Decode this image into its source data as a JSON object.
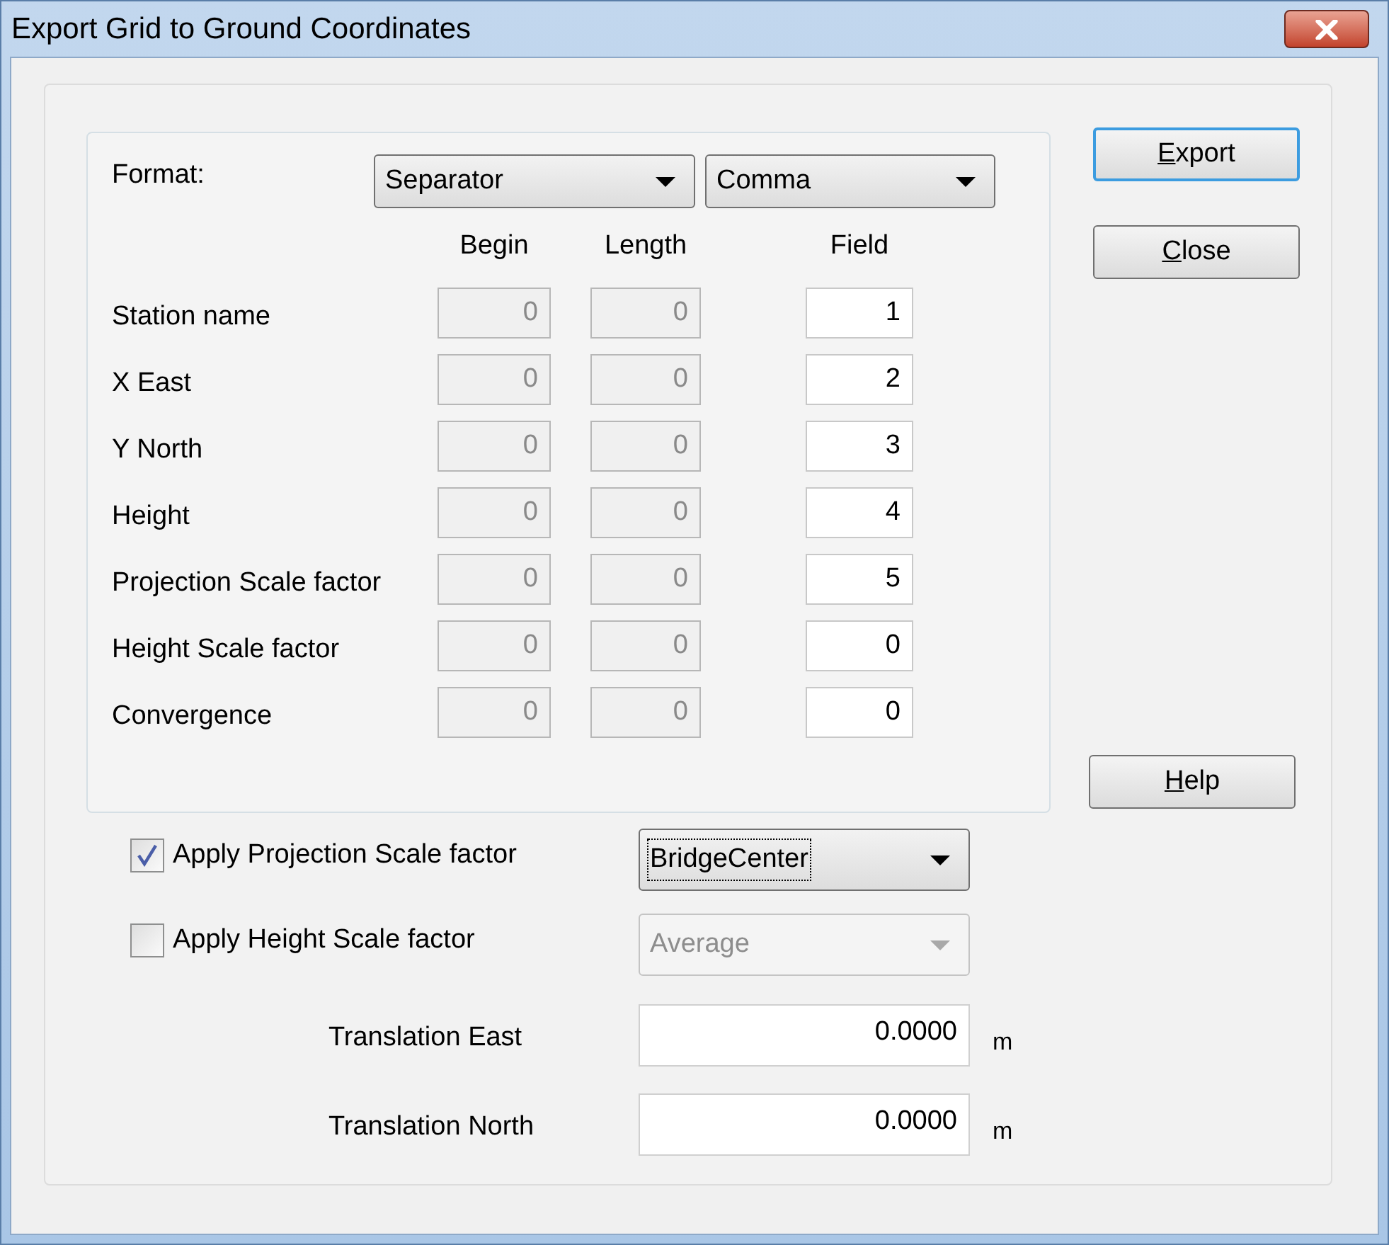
{
  "window": {
    "title": "Export Grid to Ground Coordinates"
  },
  "format": {
    "label": "Format:",
    "dropdowns": [
      {
        "value": "Separator",
        "disabled": false
      },
      {
        "value": "Comma",
        "disabled": false
      }
    ]
  },
  "columns": [
    {
      "label": "Begin",
      "disabled": true
    },
    {
      "label": "Length",
      "disabled": true
    },
    {
      "label": "Field",
      "disabled": false
    }
  ],
  "rows": [
    {
      "label": "Station name",
      "values": [
        "0",
        "0",
        "1"
      ]
    },
    {
      "label": "X East",
      "values": [
        "0",
        "0",
        "2"
      ]
    },
    {
      "label": "Y North",
      "values": [
        "0",
        "0",
        "3"
      ]
    },
    {
      "label": "Height",
      "values": [
        "0",
        "0",
        "4"
      ]
    },
    {
      "label": "Projection Scale factor",
      "values": [
        "0",
        "0",
        "5"
      ]
    },
    {
      "label": "Height Scale factor",
      "values": [
        "0",
        "0",
        "0"
      ]
    },
    {
      "label": "Convergence",
      "values": [
        "0",
        "0",
        "0"
      ]
    }
  ],
  "options": [
    {
      "label": "Apply Projection Scale factor",
      "checked": true,
      "dropdown": {
        "value": "BridgeCenter",
        "disabled": false,
        "focused": true
      }
    },
    {
      "label": "Apply Height Scale factor",
      "checked": false,
      "dropdown": {
        "value": "Average",
        "disabled": true,
        "focused": false
      }
    }
  ],
  "translations": [
    {
      "label": "Translation East",
      "value": "0.0000",
      "unit": "m"
    },
    {
      "label": "Translation North",
      "value": "0.0000",
      "unit": "m"
    }
  ],
  "buttons": [
    {
      "label": "Export",
      "default": true,
      "mnemonic_first": true
    },
    {
      "label": "Close",
      "default": false,
      "mnemonic_first": true
    },
    {
      "label": "Help",
      "default": false,
      "mnemonic_first": true
    }
  ]
}
